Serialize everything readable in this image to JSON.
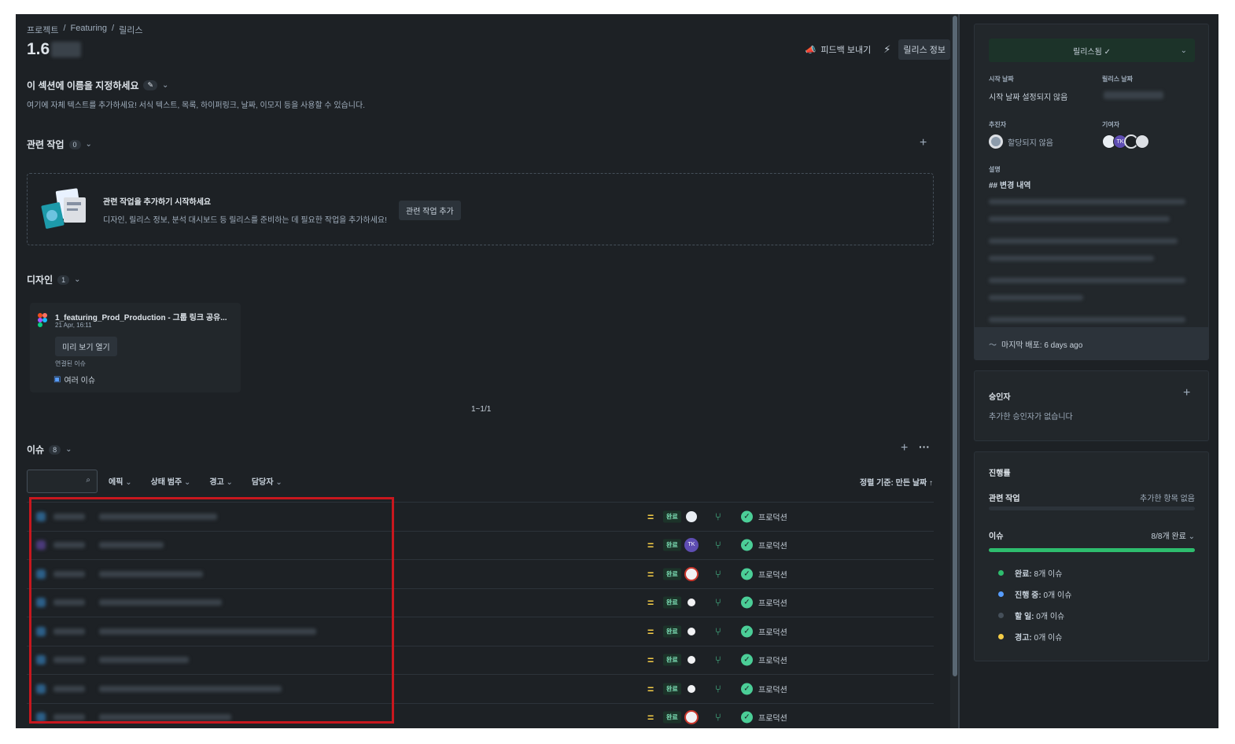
{
  "breadcrumb": [
    "프로젝트",
    "Featuring",
    "릴리스"
  ],
  "title": "1.6",
  "toolbar": {
    "feedback": "피드백 보내기",
    "info": "릴리스 정보"
  },
  "section": {
    "title": "이 섹션에 이름을 지정하세요",
    "desc": "여기에 자체 텍스트를 추가하세요! 서식 텍스트, 목록, 하이퍼링크, 날짜, 이모지 등을 사용할 수 있습니다."
  },
  "related": {
    "title": "관련 작업",
    "count": "0",
    "empty_title": "관련 작업을 추가하기 시작하세요",
    "empty_desc": "디자인, 릴리스 정보, 분석 대시보드 등 릴리스를 준비하는 데 필요한 작업을 추가하세요!",
    "add_button": "관련 작업 추가"
  },
  "design": {
    "title": "디자인",
    "count": "1",
    "file_name": "1_featuring_Prod_Production - 그룹 링크 공유...",
    "date": "21 Apr, 16:11",
    "preview": "미리 보기 열기",
    "linked_label": "연결된 이슈",
    "linked_value": "여러 이슈",
    "pager": "1~1/1"
  },
  "issues": {
    "title": "이슈",
    "count": "8",
    "filters": [
      "에픽",
      "상태 범주",
      "경고",
      "담당자"
    ],
    "sort": "정렬 기준: 만든 날짜 ↑",
    "rows": [
      {
        "status": "완료",
        "avatar": "",
        "env": "프로덕션"
      },
      {
        "status": "완료",
        "avatar": "TK",
        "env": "프로덕션"
      },
      {
        "status": "완료",
        "avatar": "",
        "env": "프로덕션"
      },
      {
        "status": "완료",
        "avatar": "",
        "env": "프로덕션"
      },
      {
        "status": "완료",
        "avatar": "",
        "env": "프로덕션"
      },
      {
        "status": "완료",
        "avatar": "",
        "env": "프로덕션"
      },
      {
        "status": "완료",
        "avatar": "",
        "env": "프로덕션"
      },
      {
        "status": "완료",
        "avatar": "",
        "env": "프로덕션"
      }
    ]
  },
  "sidebar": {
    "status_button": "릴리스됨 ✓",
    "start_label": "시작 날짜",
    "start_value": "시작 날짜 설정되지 않음",
    "release_label": "릴리스 날짜",
    "driver_label": "추진자",
    "driver_value": "할당되지 않음",
    "contrib_label": "기여자",
    "contrib_tk": "TK",
    "desc_label": "설명",
    "desc_heading": "## 변경 내역",
    "last_deploy": "마지막 배포: 6 days ago",
    "approvers_title": "승인자",
    "approvers_empty": "추가한 승인자가 없습니다",
    "progress_title": "진행률",
    "prog_related_label": "관련 작업",
    "prog_related_value": "추가한 항목 없음",
    "prog_issue_label": "이슈",
    "prog_issue_value": "8/8개 완료",
    "legend": [
      {
        "key": "완료:",
        "val": "8개 이슈",
        "color": "#2ebd6e"
      },
      {
        "key": "진행 중:",
        "val": "0개 이슈",
        "color": "#579dff"
      },
      {
        "key": "할 일:",
        "val": "0개 이슈",
        "color": "#454f59"
      },
      {
        "key": "경고:",
        "val": "0개 이슈",
        "color": "#f5cd47"
      }
    ]
  }
}
